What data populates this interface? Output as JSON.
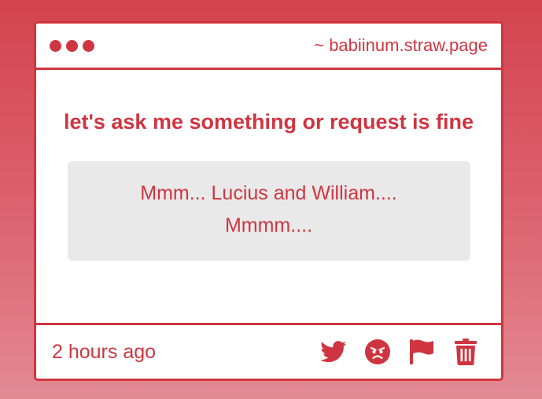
{
  "window": {
    "site": "~ babiinum.straw.page"
  },
  "post": {
    "question": "let's ask me something or request is fine",
    "answer": "Mmm... Lucius and William.... Mmmm....",
    "timestamp": "2 hours ago"
  },
  "icons": {
    "share": "twitter-icon",
    "react": "angry-face-icon",
    "report": "flag-icon",
    "delete": "trash-icon"
  },
  "colors": {
    "accent": "#cf3540",
    "answer_bg": "#eae9ea",
    "card_bg": "#ffffff"
  }
}
